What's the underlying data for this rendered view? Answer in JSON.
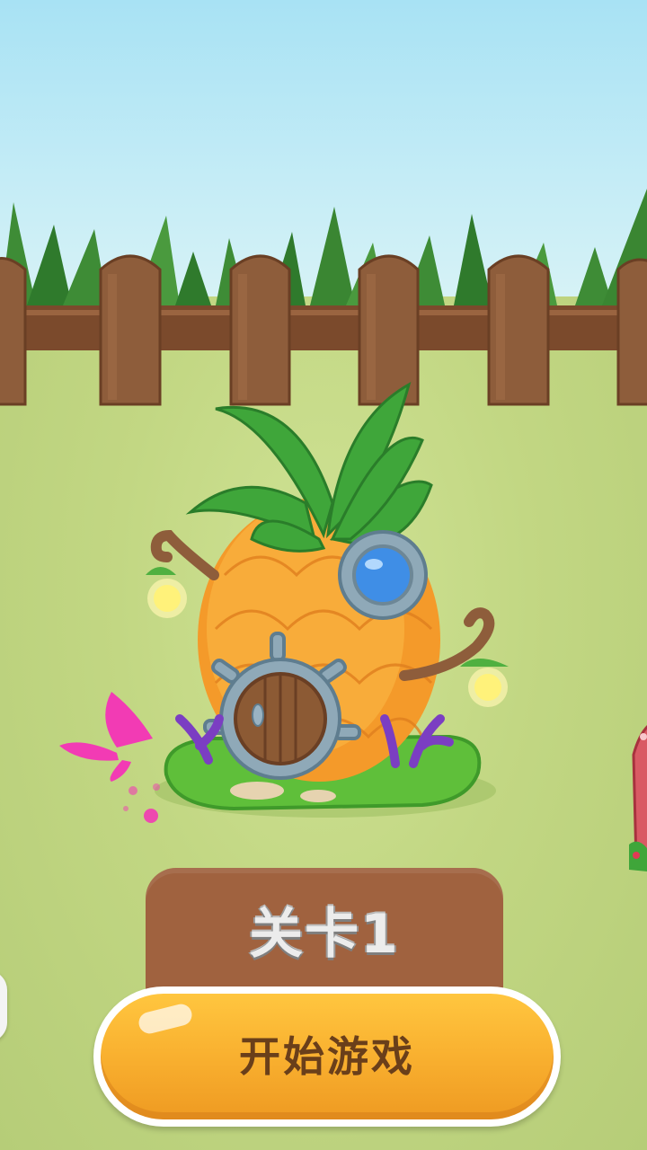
{
  "level": {
    "label": "关卡1"
  },
  "start_button": {
    "label": "开始游戏"
  },
  "colors": {
    "sky": "#b8e8f4",
    "ground": "#c4da84",
    "fence": "#8a5a3a",
    "level_plate": "#a0623f",
    "button": "#f8ae2e",
    "button_text": "#6a3f1a"
  },
  "icons": [
    "pineapple-house",
    "butterfly-icon",
    "lantern-icon",
    "mushroom-house-icon"
  ]
}
